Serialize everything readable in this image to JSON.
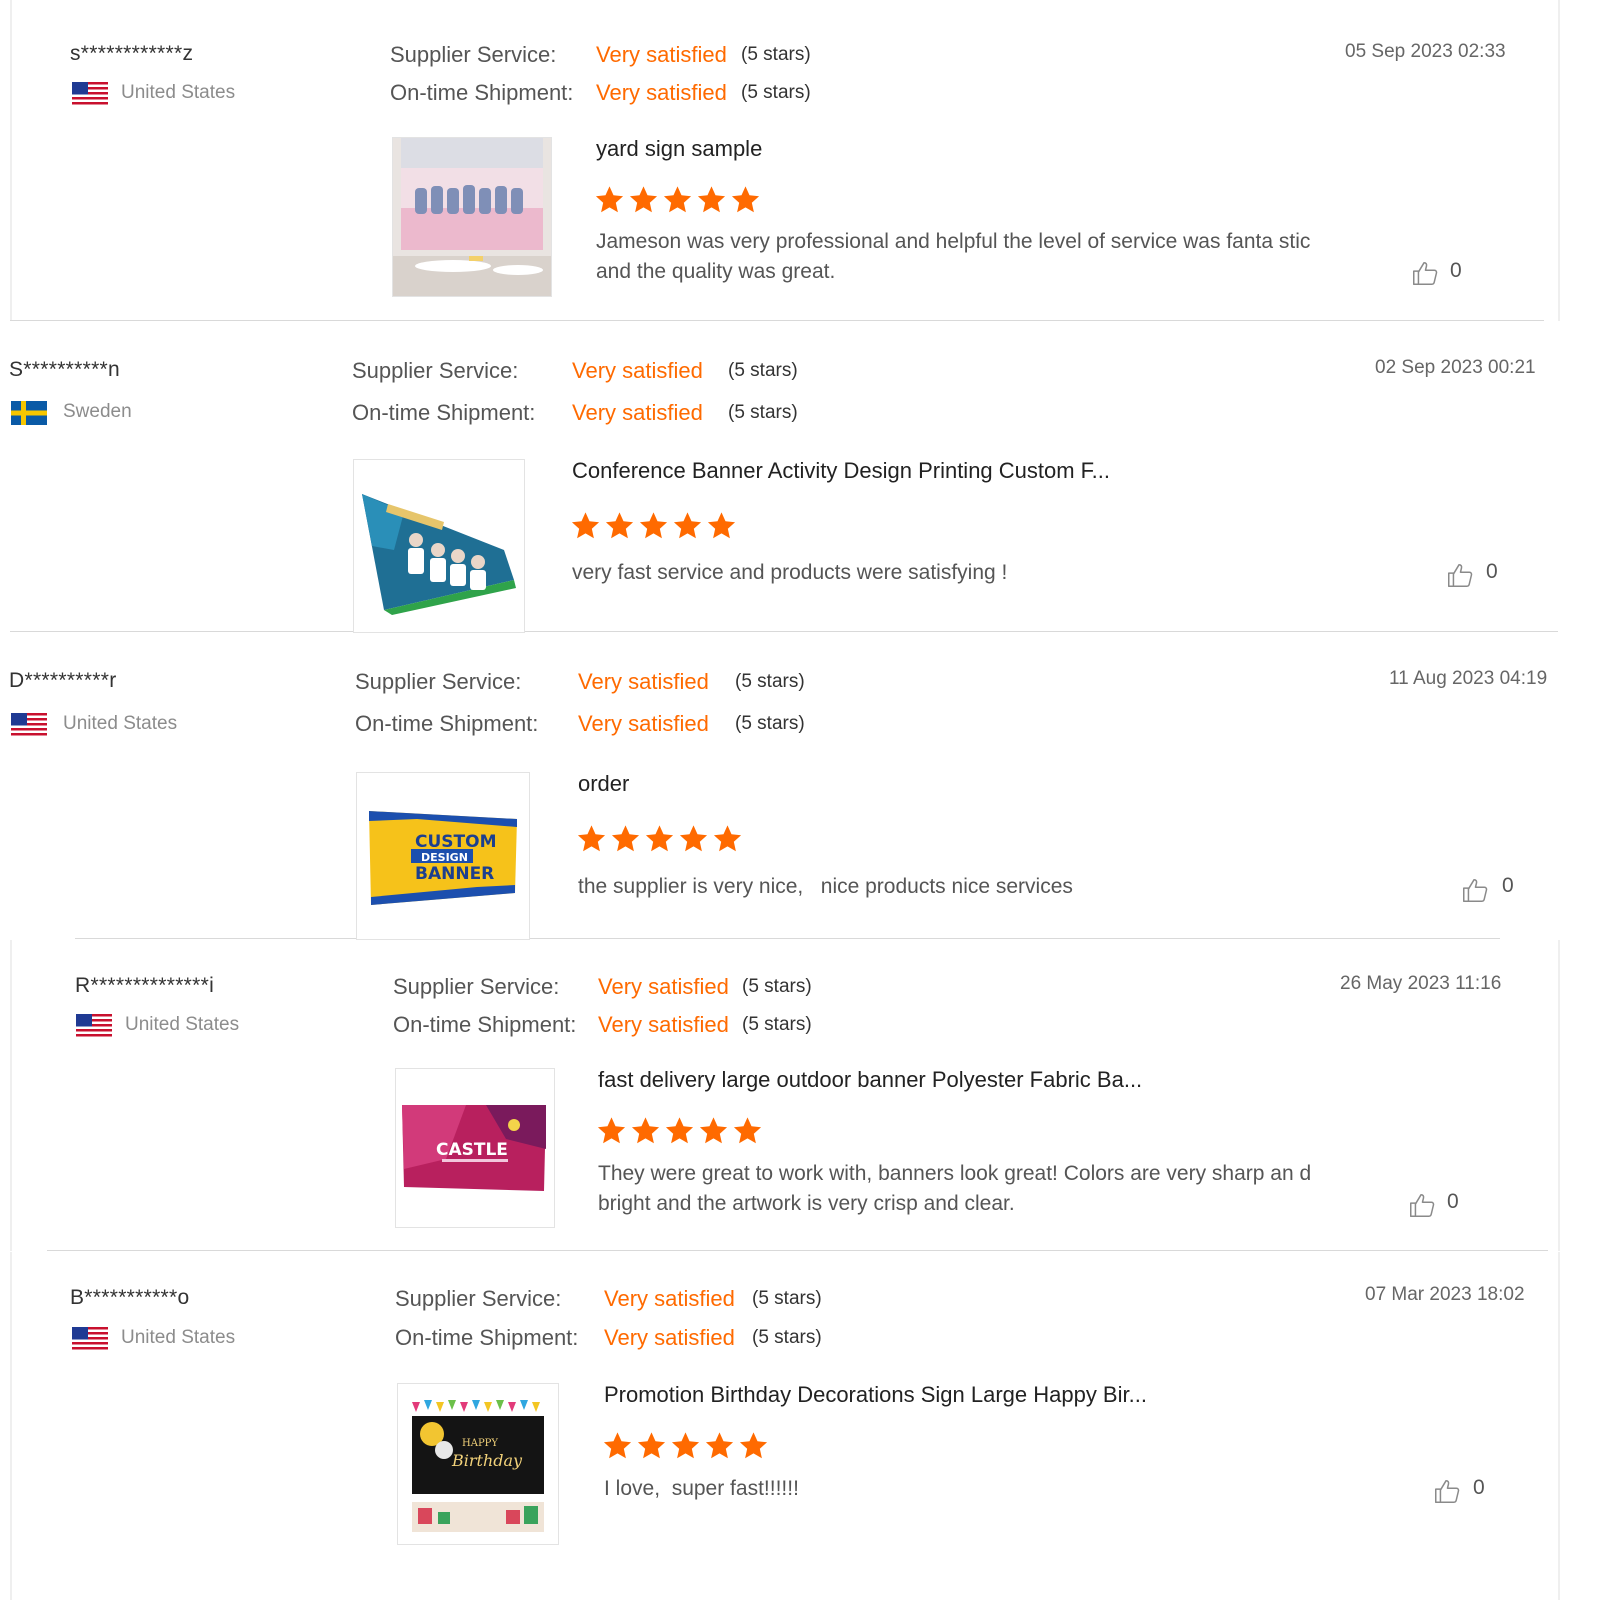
{
  "common": {
    "supplier_label": "Supplier Service:",
    "shipment_label": "On-time Shipment:",
    "rating_label": "Very satisfied",
    "stars_label": "(5 stars)"
  },
  "colors": {
    "accent": "#ff6a00",
    "star": "#ff6a00",
    "divider": "#d9d9d9"
  },
  "reviews": [
    {
      "username": "s************z",
      "country": "United States",
      "flag": "us-flag",
      "date": "05 Sep 2023 02:33",
      "title": "yard sign sample",
      "rating": 5,
      "body": "Jameson was very professional and helpful the level  of service was fanta stic and the quality was great.",
      "likes": "0"
    },
    {
      "username": "S**********n",
      "country": "Sweden",
      "flag": "sweden-flag",
      "date": "02 Sep 2023 00:21",
      "title": "Conference Banner Activity Design Printing Custom F...",
      "rating": 5,
      "body": "very fast service and products were satisfying !",
      "likes": "0"
    },
    {
      "username": "D**********r",
      "country": "United States",
      "flag": "us-flag",
      "date": "11 Aug 2023 04:19",
      "title": "order",
      "rating": 5,
      "body": "the supplier is very nice,   nice products nice services",
      "likes": "0"
    },
    {
      "username": "R**************i",
      "country": "United States",
      "flag": "us-flag",
      "date": "26 May 2023 11:16",
      "title": "fast delivery large outdoor banner Polyester Fabric Ba...",
      "rating": 5,
      "body": "They were great to work with, banners look great! Colors are very sharp an d bright and the artwork is very crisp and clear.",
      "likes": "0"
    },
    {
      "username": "B***********o",
      "country": "United States",
      "flag": "us-flag",
      "date": "07 Mar 2023 18:02",
      "title": "Promotion Birthday Decorations Sign Large Happy Bir...",
      "rating": 5,
      "body": "I love,  super fast!!!!!!",
      "likes": "0"
    }
  ],
  "images": {
    "banner3": {
      "line1": "CUSTOM",
      "line2": "DESIGN",
      "line3": "BANNER"
    },
    "banner4": {
      "line1": "CASTLE"
    },
    "banner5": {
      "line1": "HAPPY",
      "line2": "Birthday"
    }
  }
}
